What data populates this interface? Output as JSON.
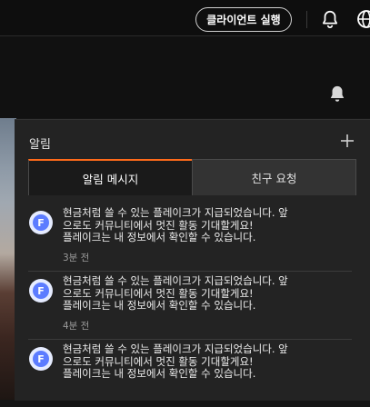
{
  "header": {
    "client_button": "클라이언트 실행"
  },
  "notifications_panel": {
    "title": "알림",
    "tabs": [
      {
        "label": "알림 메시지",
        "active": true
      },
      {
        "label": "친구 요청",
        "active": false
      }
    ],
    "items": [
      {
        "avatar_letter": "F",
        "lines": [
          "현금처럼 쓸 수 있는 플레이크가 지급되었습니다. 앞",
          "으로도 커뮤니티에서 멋진 활동 기대할게요!",
          "플레이크는 내 정보에서 확인할 수 있습니다."
        ],
        "time": "3분 전"
      },
      {
        "avatar_letter": "F",
        "lines": [
          "현금처럼 쓸 수 있는 플레이크가 지급되었습니다. 앞",
          "으로도 커뮤니티에서 멋진 활동 기대할게요!",
          "플레이크는 내 정보에서 확인할 수 있습니다."
        ],
        "time": "4분 전"
      },
      {
        "avatar_letter": "F",
        "lines": [
          "현금처럼 쓸 수 있는 플레이크가 지급되었습니다. 앞",
          "으로도 커뮤니티에서 멋진 활동 기대할게요!",
          "플레이크는 내 정보에서 확인할 수 있습니다."
        ],
        "time": ""
      }
    ]
  },
  "colors": {
    "accent": "#ff6a1a",
    "avatar": "#5c7cff"
  }
}
